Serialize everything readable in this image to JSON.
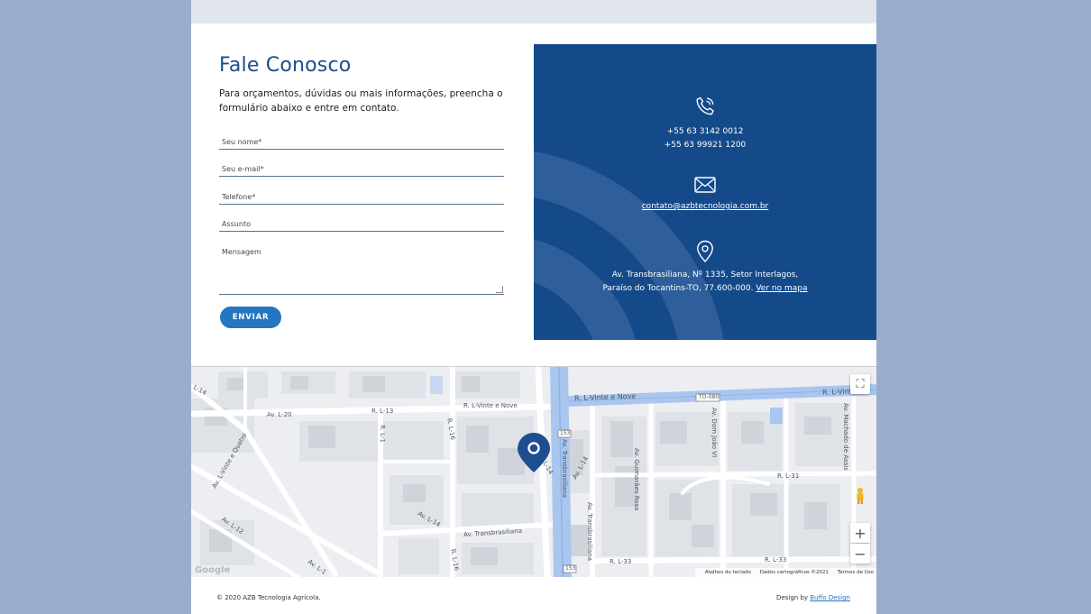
{
  "contact": {
    "title": "Fale Conosco",
    "intro": "Para orçamentos, dúvidas ou mais informações, preencha o formulário abaixo e entre em contato.",
    "fields": {
      "name_placeholder": "Seu nome*",
      "email_placeholder": "Seu e-mail*",
      "phone_placeholder": "Telefone*",
      "subject_placeholder": "Assunto",
      "message_placeholder": "Mensagem"
    },
    "submit_label": "ENVIAR"
  },
  "info": {
    "accent_color": "#144a8a",
    "phone_icon": "phone-icon",
    "phone_1": "+55 63 3142 0012",
    "phone_2": "+55 63 99921 1200",
    "email_icon": "envelope-icon",
    "email": "contato@azbtecnologia.com.br",
    "location_icon": "location-pin-icon",
    "address_1": "Av. Transbrasiliana, Nº 1335, Setor Interlagos,",
    "address_2": "Paraíso do Tocantins-TO, 77.600-000.",
    "map_link": "Ver no mapa"
  },
  "map": {
    "streets": {
      "l_vinte_e_nove_big": "R. L-Vinte e Nove",
      "l_vinte_e_nove_small": "R. L-Vinte e Nove",
      "l_vinte_e_nove_right": "R. L-Vinte e",
      "av_l20": "Av. L-20",
      "r_l13": "R. L-13",
      "r_l1": "R. L-1",
      "r_l16a": "R. L-16",
      "r_l16b": "R. L-16",
      "l14_top": "L-14",
      "av_l14": "Av. L-14",
      "av_l14_b": "Av. L-14",
      "l14_small": "L-14",
      "av_l12": "Av. L-12",
      "av_l_vinte_quatro": "Av. L-Vinte e Quatro",
      "av_transbrasiliana_a": "Av. Transbrasiliana",
      "av_transbrasiliana_b": "Av. Transbrasiliana",
      "av_transbrasiliana_c": "Av. Transbrasiliana",
      "av_guimaraes_rosa": "Av. Guimarães Rosa",
      "av_dom_joao_vi": "Av. Dom João VI",
      "av_machado_assis": "Av. Machado de Assis",
      "r_l31": "R. L-31",
      "r_l33a": "R. L-33",
      "r_l33b": "R. L-33",
      "av_l1_bottom": "Av. L-1",
      "to_080": "TO-080",
      "br_153_a": "153",
      "br_153_b": "153"
    },
    "attribution": {
      "shortcuts": "Atalhos do teclado",
      "map_data": "Dados cartográficos ©2021",
      "terms": "Termos de Uso"
    },
    "google": "Google",
    "marker_color": "#1d4e8f",
    "road_color": "#a9c6ef"
  },
  "footer": {
    "copyright": "© 2020 AZB Tecnologia Agrícola.",
    "design_by": "Design by",
    "designer": "Buffo Design"
  }
}
